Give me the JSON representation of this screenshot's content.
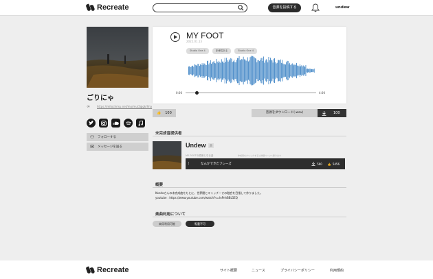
{
  "header": {
    "logo_text": "Recreate",
    "search_placeholder": "",
    "post_button": "音源を投稿する",
    "user": "undew"
  },
  "artist": {
    "name": "ごりにゃ",
    "link_url": "https://mitochrisu.net/mu/mu/2qjgk/hha",
    "follow_label": "フォローする",
    "message_label": "メッセージを送る",
    "social_icons": [
      "twitter-icon",
      "instagram-icon",
      "soundcloud-icon",
      "spotify-icon",
      "music-note-icon"
    ]
  },
  "player": {
    "title": "MY FOOT",
    "date": "2022.01.13",
    "tags": [
      "Studio One 4",
      "多様性ある",
      "Studio One 4"
    ],
    "time_current": "0:00",
    "time_total": "4:00",
    "accent": "#3b82c4"
  },
  "actions": {
    "like_count": "100",
    "download_label": "音源をダウンロード(.wav)",
    "download_count": "100"
  },
  "incomplete": {
    "heading": "未完成音提供者",
    "name": "Undew",
    "badge": "声",
    "description": "MY FOOTの原案となる曲",
    "description2": "作成者をクリックすると詳細ページへ移ります",
    "phrase": "なんかできたフレーズ",
    "plays": "560",
    "likes": "5456"
  },
  "summary": {
    "heading": "概要",
    "line1": "Kondoさんの未完成曲をもとに、世界観とキャッチーさの融合を目指して作りました。",
    "line2": "youtube : https://www.youtube.com/watch?v=InPnhBBL5EQ"
  },
  "usage": {
    "heading": "楽曲利用について",
    "pill1": "商用利用可能",
    "pill2": "転載不可"
  },
  "footer": {
    "logo_text": "Recreate",
    "links": [
      "サイト概要",
      "ニュース",
      "プライバシーポリシー",
      "利用規約"
    ]
  }
}
